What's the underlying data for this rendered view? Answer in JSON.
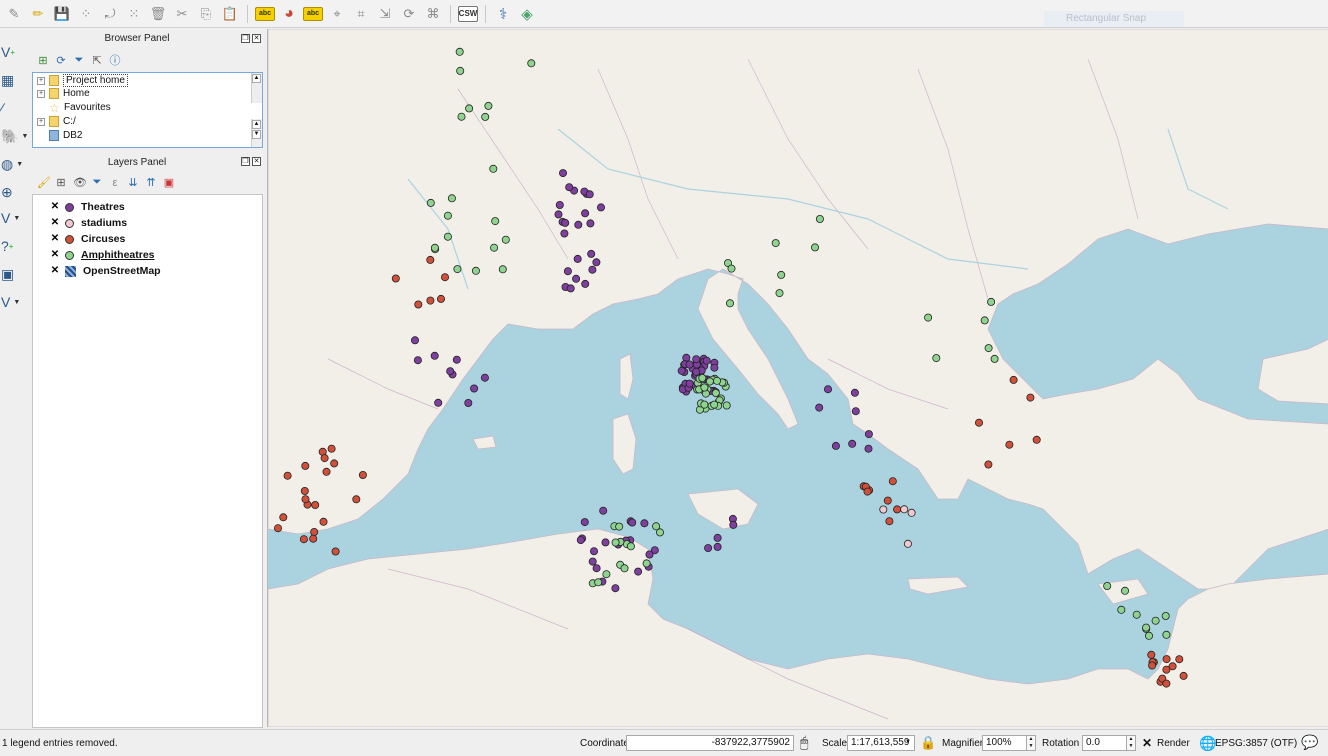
{
  "toolbar": {
    "ghost_label": "Rectangular Snap",
    "csw_label": "CSW",
    "abc_label": "abc"
  },
  "browser_panel": {
    "title": "Browser Panel",
    "items": [
      {
        "label": "Project home",
        "icon": "folder-icon",
        "selected": true
      },
      {
        "label": "Home",
        "icon": "folder-icon"
      },
      {
        "label": "Favourites",
        "icon": "star-icon"
      },
      {
        "label": "C:/",
        "icon": "folder-icon"
      },
      {
        "label": "DB2",
        "icon": "database-icon"
      }
    ]
  },
  "layers_panel": {
    "title": "Layers Panel",
    "layers": [
      {
        "name": "Theatres",
        "color": "#7e3f9e",
        "type": "point"
      },
      {
        "name": "stadiums",
        "color": "#f0c8cf",
        "type": "point"
      },
      {
        "name": "Circuses",
        "color": "#d0503a",
        "type": "point"
      },
      {
        "name": "Amphitheatres",
        "color": "#8ed38e",
        "type": "point"
      },
      {
        "name": "OpenStreetMap",
        "color": "#2b4d86",
        "type": "raster"
      }
    ]
  },
  "statusbar": {
    "message": "1 legend entries removed.",
    "coordinate_label": "Coordinate",
    "coordinate_value": "-837922,3775902",
    "scale_label": "Scale",
    "scale_value": "1:17,613,559",
    "magnifier_label": "Magnifier",
    "magnifier_value": "100%",
    "rotation_label": "Rotation",
    "rotation_value": "0.0",
    "render_label": "Render",
    "crs_label": "EPSG:3857 (OTF)"
  },
  "colors": {
    "sea": "#aad3df",
    "land": "#f2efe9",
    "theatres": "#7e3f9e",
    "stadiums": "#f0c8cf",
    "circuses": "#d0503a",
    "amphitheatres": "#8ed38e"
  }
}
